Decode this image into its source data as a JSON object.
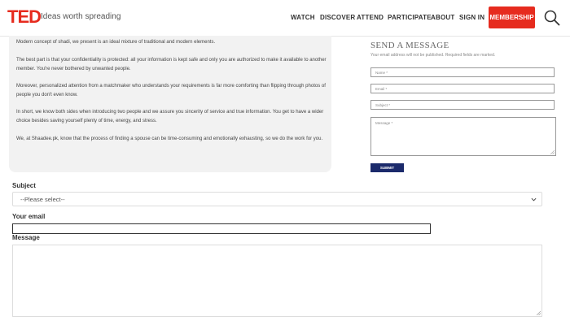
{
  "header": {
    "logo": "TED",
    "tagline": "Ideas worth spreading",
    "nav": [
      "WATCH",
      "DISCOVER",
      "ATTEND",
      "PARTICIPATE",
      "ABOUT",
      "SIGN IN"
    ],
    "membership_label": "MEMBERSHIP",
    "search_icon": "search-icon"
  },
  "card": {
    "paragraphs": [
      "Modern concept of shadi, we present is an ideal mixture of traditional and modern elements.",
      "The best part is that your confidentiality is protected: all your information is kept safe and only you are authorized to make it available to another member. You're never bothered by unwanted people.",
      "Moreover, personalized attention from a matchmaker who understands your requirements is far more comforting than flipping through photos of people you don't even know.",
      "In short, we know both sides when introducing two people and we assure you sincerity of service and true information. You get to have a wider choice besides saving yourself plenty of time, energy, and stress.",
      "We, at Shaadee.pk, know that the process of finding a spouse can be time-consuming and emotionally exhausting, so we do the work for you."
    ]
  },
  "send_message": {
    "title": "SEND A MESSAGE",
    "note": "Your email address will not be published. Required fields are marked.",
    "name_placeholder": "Name *",
    "email_placeholder": "Email *",
    "subject_placeholder": "Subject *",
    "message_placeholder": "Message *",
    "submit_label": "SUBMIT"
  },
  "form": {
    "subject_label": "Subject",
    "subject_value": "--Please select--",
    "email_label": "Your email",
    "message_label": "Message"
  },
  "colors": {
    "brand_red": "#e62b1e",
    "submit_navy": "#1b2a6b"
  }
}
